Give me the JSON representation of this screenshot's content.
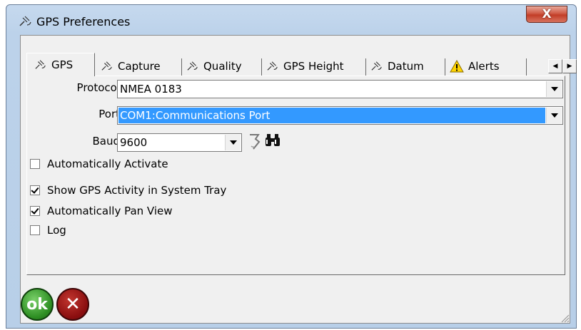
{
  "window": {
    "title": "GPS Preferences",
    "close_label": "X"
  },
  "tabs": [
    {
      "label": "GPS",
      "icon": "satellite-icon"
    },
    {
      "label": "Capture",
      "icon": "satellite-icon"
    },
    {
      "label": "Quality",
      "icon": "satellite-icon"
    },
    {
      "label": "GPS Height",
      "icon": "satellite-icon"
    },
    {
      "label": "Datum",
      "icon": "satellite-icon"
    },
    {
      "label": "Alerts",
      "icon": "warning-icon"
    }
  ],
  "form": {
    "protocol": {
      "label": "Protocol",
      "value": "NMEA 0183"
    },
    "port": {
      "label": "Port",
      "value": "COM1:Communications Port"
    },
    "baud": {
      "label": "Baud",
      "value": "9600"
    }
  },
  "options": [
    {
      "label": "Automatically Activate",
      "checked": false
    },
    {
      "label": "Show GPS Activity in System Tray",
      "checked": true
    },
    {
      "label": "Automatically Pan View",
      "checked": true
    },
    {
      "label": "Log",
      "checked": false
    }
  ],
  "buttons": {
    "ok_label": "ok",
    "cancel_label": "✕"
  },
  "colors": {
    "selection": "#3399ff",
    "ok": "#2e8f23",
    "cancel": "#8c0f10"
  }
}
